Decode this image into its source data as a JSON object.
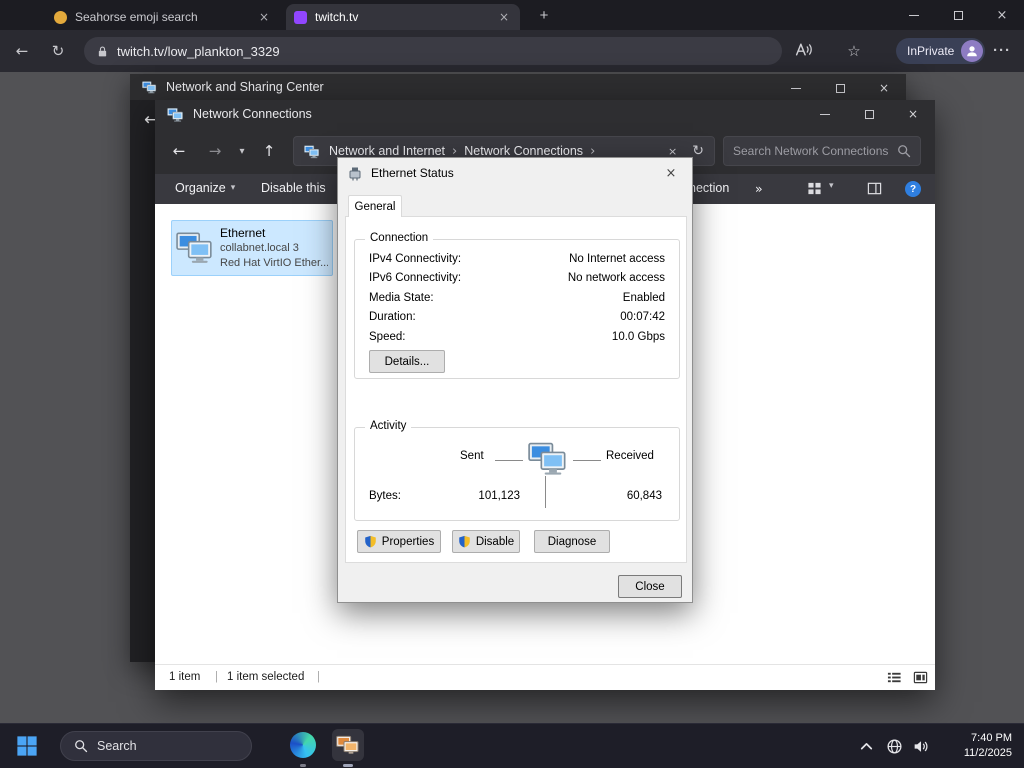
{
  "browser": {
    "tabs": [
      {
        "title": "Seahorse emoji search"
      },
      {
        "title": "twitch.tv"
      }
    ],
    "url": "twitch.tv/low_plankton_3329",
    "inprivate_label": "InPrivate"
  },
  "sharing_center": {
    "title": "Network and Sharing Center"
  },
  "connections": {
    "title": "Network Connections",
    "breadcrumb": {
      "root": "Network and Internet",
      "current": "Network Connections"
    },
    "search_placeholder": "Search Network Connections",
    "commandbar": {
      "organize": "Organize",
      "disable_this": "Disable this",
      "overflow_text": "nection",
      "more": "»"
    },
    "item": {
      "name": "Ethernet",
      "network": "collabnet.local 3",
      "device": "Red Hat VirtIO Ether..."
    },
    "status": {
      "count": "1 item",
      "selected": "1 item selected"
    }
  },
  "dialog": {
    "title": "Ethernet Status",
    "tab_general": "General",
    "connection": {
      "label": "Connection",
      "rows": [
        {
          "label": "IPv4 Connectivity:",
          "value": "No Internet access"
        },
        {
          "label": "IPv6 Connectivity:",
          "value": "No network access"
        },
        {
          "label": "Media State:",
          "value": "Enabled"
        },
        {
          "label": "Duration:",
          "value": "00:07:42"
        },
        {
          "label": "Speed:",
          "value": "10.0 Gbps"
        }
      ],
      "details_button": "Details..."
    },
    "activity": {
      "label": "Activity",
      "sent": "Sent",
      "received": "Received",
      "bytes_label": "Bytes:",
      "sent_bytes": "101,123",
      "received_bytes": "60,843"
    },
    "buttons": {
      "properties": "Properties",
      "disable": "Disable",
      "diagnose": "Diagnose",
      "close": "Close"
    }
  },
  "taskbar": {
    "search": "Search",
    "time": "7:40 PM",
    "date": "11/2/2025"
  },
  "colors": {
    "accent": "#0078d4",
    "selection": "#cce8ff",
    "inprivate_badge": "#3a4056"
  }
}
